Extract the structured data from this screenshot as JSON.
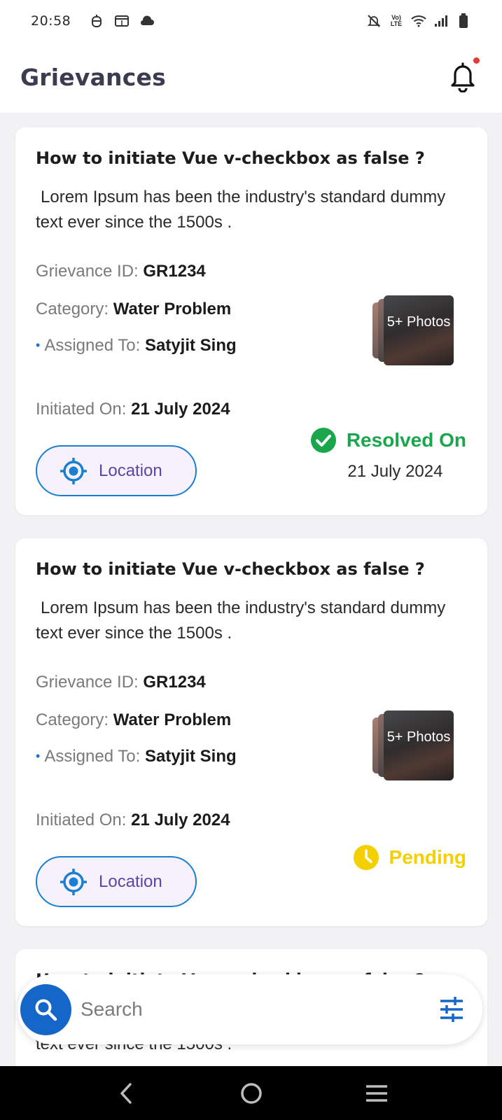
{
  "status_bar": {
    "time": "20:58",
    "left_icons": [
      "bug-icon",
      "tab-icon",
      "cloud-icon"
    ],
    "right_icons": [
      "bell-off-icon",
      "volte-icon",
      "wifi-icon",
      "signal-icon",
      "battery-icon"
    ]
  },
  "header": {
    "title": "Grievances",
    "notification_icon": "bell-icon"
  },
  "cards": [
    {
      "title": "How to initiate Vue v-checkbox as false ?",
      "description": "Lorem Ipsum has been the industry's standard dummy text ever since the 1500s .",
      "grievance_id_label": "Grievance ID:",
      "grievance_id": "GR1234",
      "category_label": "Category:",
      "category": "Water Problem",
      "assigned_label": "Assigned To:",
      "assigned_to": "Satyjit Sing",
      "initiated_label": "Initiated On:",
      "initiated_on": "21 July 2024",
      "photos_label": "5+ Photos",
      "location_label": "Location",
      "status": "Resolved On",
      "status_date": "21 July 2024",
      "status_color": "#1aa64b",
      "status_icon": "check-circle-icon"
    },
    {
      "title": "How to initiate Vue v-checkbox as false ?",
      "description": "Lorem Ipsum has been the industry's standard dummy text ever since the 1500s .",
      "grievance_id_label": "Grievance ID:",
      "grievance_id": "GR1234",
      "category_label": "Category:",
      "category": "Water Problem",
      "assigned_label": "Assigned To:",
      "assigned_to": "Satyjit Sing",
      "initiated_label": "Initiated On:",
      "initiated_on": "21 July 2024",
      "photos_label": "5+ Photos",
      "location_label": "Location",
      "status": "Pending",
      "status_color": "#f5d000",
      "status_icon": "clock-icon"
    },
    {
      "title": "How to initiate Vue v-checkbox as false ?",
      "description": "Lorem Ipsum has been the industry's standard dummy text ever since the 1500s ."
    }
  ],
  "search": {
    "placeholder": "Search",
    "search_icon": "search-icon",
    "filter_icon": "filter-icon"
  },
  "nav_bar": {
    "icons": [
      "back-icon",
      "home-icon",
      "recents-icon"
    ]
  },
  "colors": {
    "accent": "#1466c8",
    "location_border": "#1a7fd1",
    "location_text": "#5b45a6",
    "resolved": "#1aa64b",
    "pending": "#f5d000",
    "title": "#3a3d4f"
  }
}
